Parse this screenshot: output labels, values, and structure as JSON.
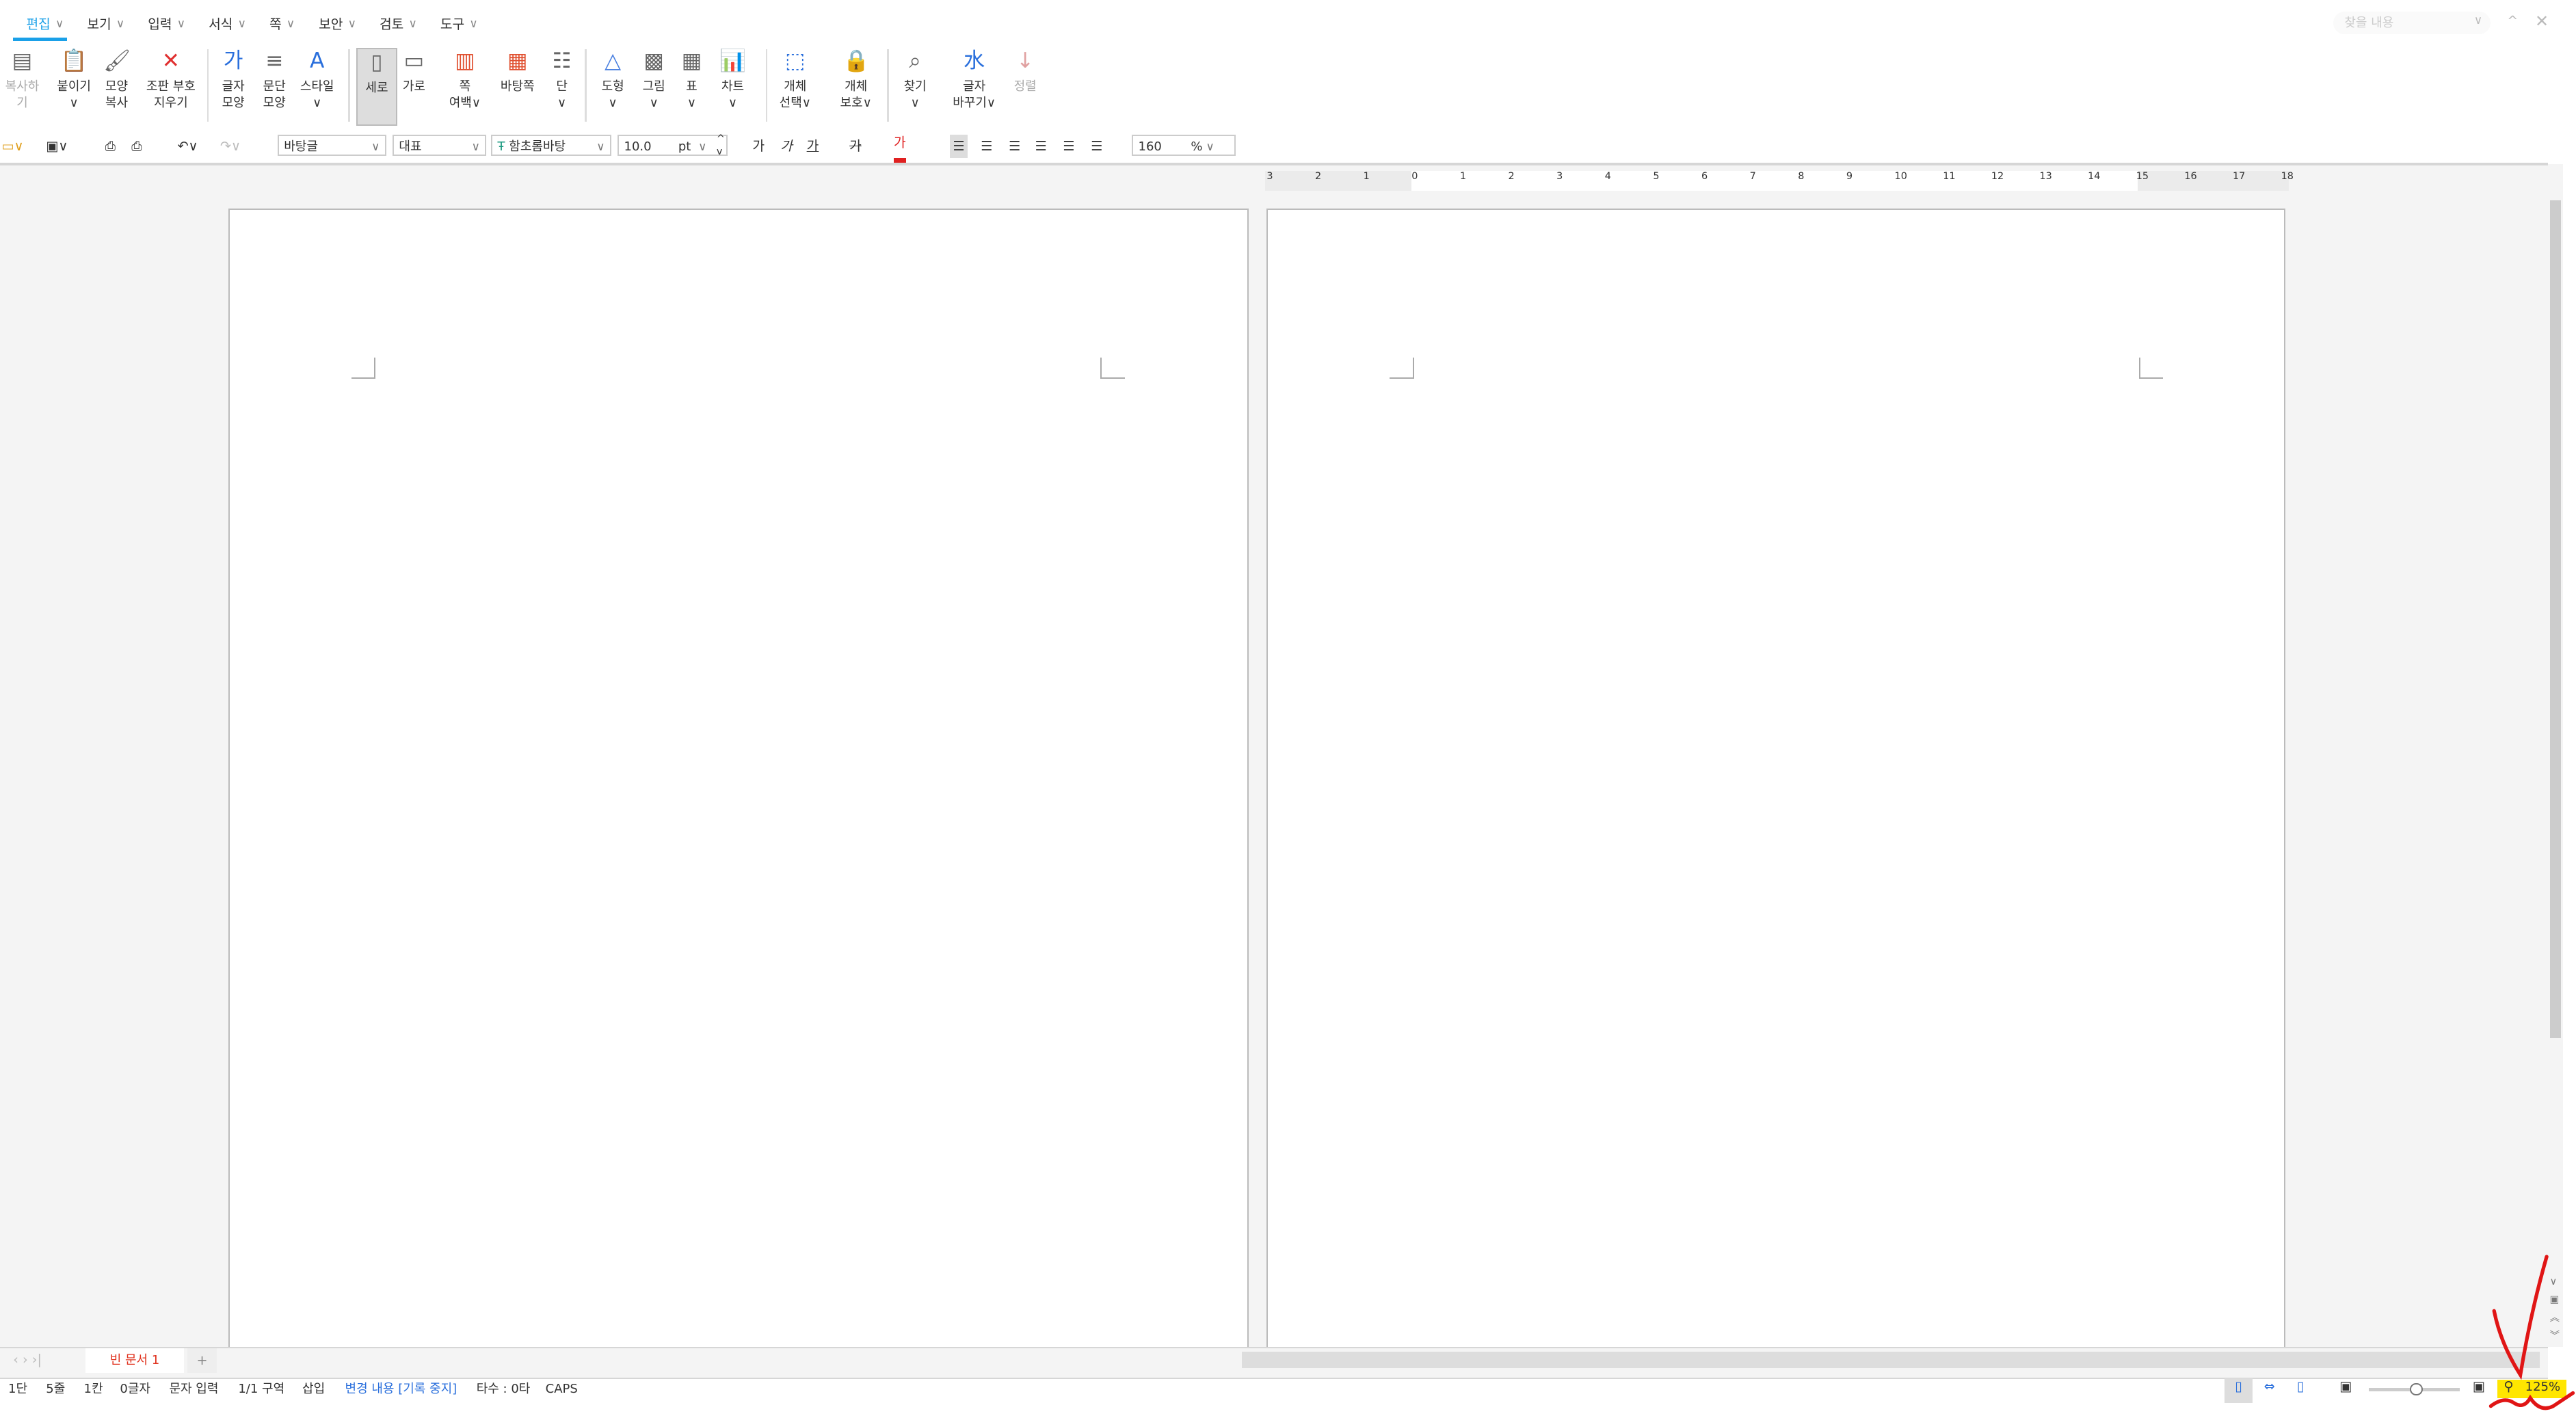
{
  "menu_tabs": [
    {
      "label": "편집"
    },
    {
      "label": "보기"
    },
    {
      "label": "입력"
    },
    {
      "label": "서식"
    },
    {
      "label": "쪽"
    },
    {
      "label": "보안"
    },
    {
      "label": "검토"
    },
    {
      "label": "도구"
    }
  ],
  "active_tab": "편집",
  "find": {
    "placeholder": "찾을 내용"
  },
  "ribbon": [
    {
      "l1": "복사하기",
      "l2": "",
      "icon": "copy-icon"
    },
    {
      "l1": "붙이기",
      "l2": "∨",
      "icon": "paste-icon"
    },
    {
      "l1": "모양",
      "l2": "복사",
      "icon": "format-painter-icon"
    },
    {
      "l1": "조판 부호",
      "l2": "지우기",
      "icon": "clear-marks-icon"
    },
    {
      "l1": "글자",
      "l2": "모양",
      "icon": "char-shape-icon"
    },
    {
      "l1": "문단",
      "l2": "모양",
      "icon": "para-shape-icon"
    },
    {
      "l1": "스타일",
      "l2": "∨",
      "icon": "style-icon"
    },
    {
      "l1": "세로",
      "l2": "",
      "icon": "portrait-icon"
    },
    {
      "l1": "가로",
      "l2": "",
      "icon": "landscape-icon"
    },
    {
      "l1": "쪽",
      "l2": "여백∨",
      "icon": "margin-icon"
    },
    {
      "l1": "바탕쪽",
      "l2": "",
      "icon": "master-page-icon"
    },
    {
      "l1": "단",
      "l2": "∨",
      "icon": "columns-icon"
    },
    {
      "l1": "도형",
      "l2": "∨",
      "icon": "shape-icon"
    },
    {
      "l1": "그림",
      "l2": "∨",
      "icon": "picture-icon"
    },
    {
      "l1": "표",
      "l2": "∨",
      "icon": "table-icon"
    },
    {
      "l1": "차트",
      "l2": "∨",
      "icon": "chart-icon"
    },
    {
      "l1": "개체",
      "l2": "선택∨",
      "icon": "select-object-icon"
    },
    {
      "l1": "개체",
      "l2": "보호∨",
      "icon": "protect-object-icon"
    },
    {
      "l1": "찾기",
      "l2": "∨",
      "icon": "find-icon"
    },
    {
      "l1": "글자",
      "l2": "바꾸기∨",
      "icon": "replace-icon"
    },
    {
      "l1": "정렬",
      "l2": "",
      "icon": "sort-icon"
    }
  ],
  "toolbar": {
    "style": "바탕글",
    "lang": "대표",
    "font": "함초롬바탕",
    "size": "10.0",
    "size_unit": "pt",
    "char_a": "가",
    "char_b": "가",
    "char_c": "가",
    "char_d": "가",
    "char_e": "가",
    "line_spacing": "160",
    "line_unit": "%"
  },
  "ruler": {
    "labels": [
      "3",
      "2",
      "1",
      "0",
      "1",
      "2",
      "3",
      "4",
      "5",
      "6",
      "7",
      "8",
      "9",
      "10",
      "11",
      "12",
      "13",
      "14",
      "15",
      "16",
      "17",
      "18"
    ]
  },
  "doc_tabs": [
    {
      "label": "빈 문서 1"
    }
  ],
  "status": {
    "col": "1단",
    "line": "5줄",
    "cell": "1칸",
    "chars": "0글자",
    "mode": "문자 입력",
    "section": "1/1 구역",
    "insert": "삽입",
    "track": "변경 내용 [기록 중지]",
    "typing": "타수 : 0타",
    "caps": "CAPS",
    "zoom": "125%"
  },
  "colors": {
    "accent": "#1aa0e8",
    "doc_tab": "#e0321e",
    "track": "#2a6fdc",
    "highlight": "#ffe600",
    "annotation": "#e01515"
  }
}
